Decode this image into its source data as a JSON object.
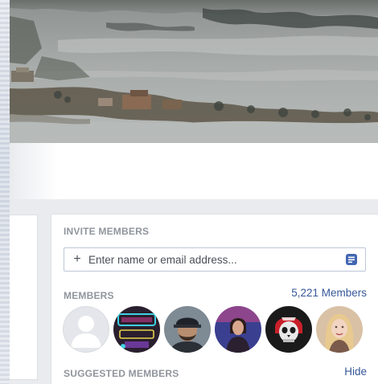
{
  "invite": {
    "title": "INVITE MEMBERS",
    "placeholder": "Enter name or email address...",
    "plus_icon": "+"
  },
  "members": {
    "title": "MEMBERS",
    "count_label": "5,221 Members",
    "avatars": [
      {
        "icon": "default-avatar-silhouette",
        "colors": [
          "#e4e6eb",
          "#ffffff"
        ]
      },
      {
        "icon": "avatar-neon-sign",
        "colors": [
          "#2a1f2e",
          "#c23a8a",
          "#3fd0e0"
        ]
      },
      {
        "icon": "avatar-man-cap-beard",
        "colors": [
          "#7e8a94",
          "#2b2f36",
          "#b88e70"
        ]
      },
      {
        "icon": "avatar-woman-stage",
        "colors": [
          "#3a3f8f",
          "#c54a8a",
          "#2b2030"
        ]
      },
      {
        "icon": "avatar-skull-helmet",
        "colors": [
          "#1a1a1a",
          "#c8202a",
          "#e8e8e8"
        ]
      },
      {
        "icon": "avatar-woman-blonde",
        "colors": [
          "#d9c1a5",
          "#e8c98f",
          "#f2d4c2"
        ]
      }
    ]
  },
  "suggested": {
    "title": "SUGGESTED MEMBERS",
    "hide_label": "Hide"
  },
  "colors": {
    "link": "#365899",
    "section_title": "#90949c",
    "background": "#e9ebee",
    "contact_icon": "#4267b2"
  }
}
